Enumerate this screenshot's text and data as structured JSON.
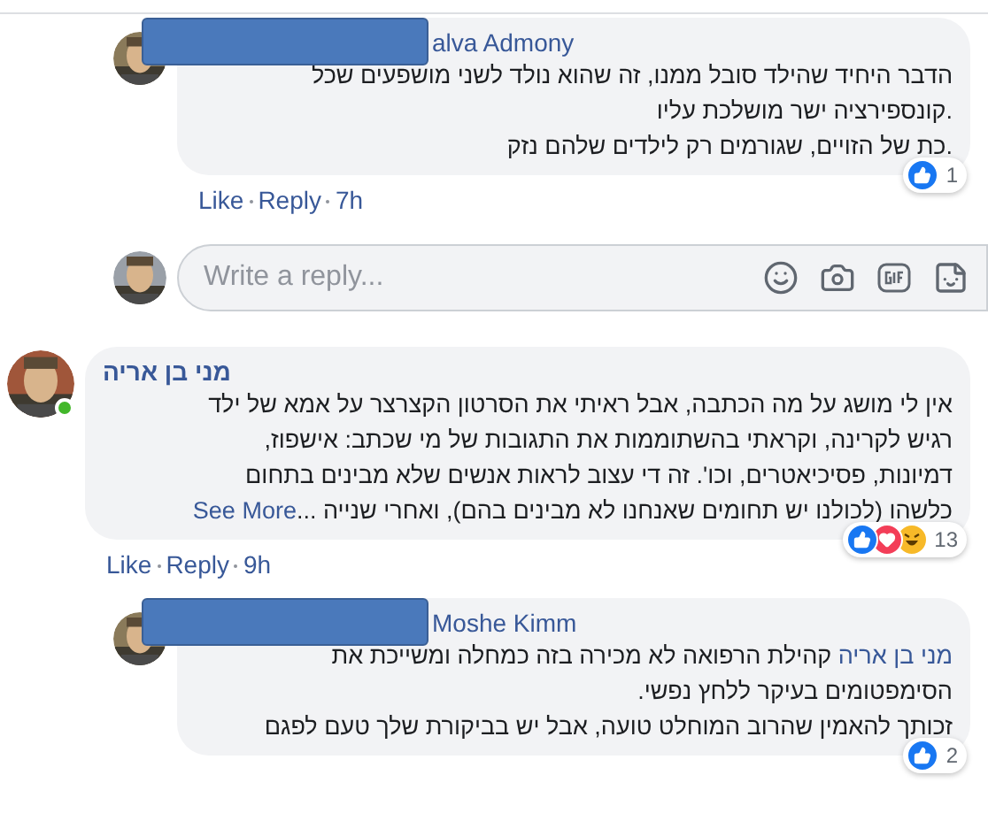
{
  "comments": [
    {
      "kind": "reply",
      "redacted": true,
      "author": "alva Admony",
      "lines": [
        [
          {
            "text": "הדבר היחיד שהילד סובל ממנו, זה שהוא נולד לשני מושפעים שכל"
          }
        ],
        [
          {
            "text": ".קונספירציה ישר מושלכת עליו"
          }
        ],
        [
          {
            "text": ".כת של הזויים, שגורמים רק לילדים שלהם נזק"
          }
        ]
      ],
      "actions": {
        "like": "Like",
        "reply": "Reply",
        "time": "7h"
      },
      "reactions": [
        {
          "kind": "like"
        }
      ],
      "reaction_count": "1"
    },
    {
      "kind": "input",
      "placeholder": "Write a reply..."
    },
    {
      "kind": "comment",
      "redacted": false,
      "online": true,
      "author": "מני בן אריה",
      "lines": [
        [
          {
            "text": "אין לי מושג על מה הכתבה, אבל ראיתי את הסרטון הקצרצר על אמא של ילד"
          }
        ],
        [
          {
            "text": "רגיש לקרינה, וקראתי בהשתוממות את התגובות של מי שכתב: אישפוז,"
          }
        ],
        [
          {
            "text": "דמיונות, פסיכיאטרים, וכו'. זה די עצוב לראות אנשים שלא מבינים בתחום"
          }
        ],
        [
          {
            "text": "כלשהו (לכולנו יש תחומים שאנחנו לא מבינים בהם), ואחרי שנייה ..."
          },
          {
            "text": "See More",
            "link": true
          }
        ]
      ],
      "actions": {
        "like": "Like",
        "reply": "Reply",
        "time": "9h"
      },
      "reactions": [
        {
          "kind": "like"
        },
        {
          "kind": "love"
        },
        {
          "kind": "haha"
        }
      ],
      "reaction_count": "13"
    },
    {
      "kind": "reply",
      "redacted": true,
      "author": "Moshe Kimm",
      "lines": [
        [
          {
            "text": "מני בן אריה",
            "link": true
          },
          {
            "text": " קהילת הרפואה לא מכירה בזה כמחלה ומשייכת את"
          }
        ],
        [
          {
            "text": "הסימפטומים בעיקר ללחץ נפשי."
          }
        ],
        [
          {
            "text": "זכותך להאמין שהרוב המוחלט טועה, אבל יש בביקורת שלך טעם לפגם"
          }
        ]
      ],
      "reactions": [
        {
          "kind": "like"
        }
      ],
      "reaction_count": "2"
    }
  ]
}
